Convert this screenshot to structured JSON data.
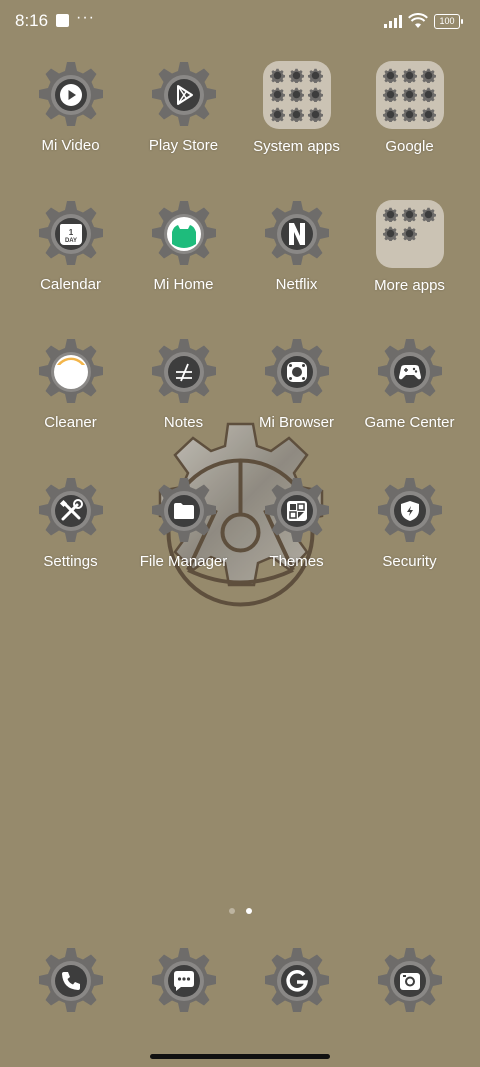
{
  "status_bar": {
    "time": "8:16",
    "battery": "100",
    "icons": [
      "notification-square-icon",
      "more-dots-icon",
      "signal-icon",
      "wifi-icon",
      "battery-icon"
    ]
  },
  "home": {
    "apps": [
      {
        "label": "Mi Video",
        "icon": "play-icon"
      },
      {
        "label": "Play Store",
        "icon": "play-store-icon"
      },
      {
        "label": "System apps",
        "icon": "folder-icon"
      },
      {
        "label": "Google",
        "icon": "folder-icon"
      },
      {
        "label": "Calendar",
        "icon": "calendar-icon",
        "glyph_text": "1\nDAY"
      },
      {
        "label": "Mi Home",
        "icon": "mi-home-icon"
      },
      {
        "label": "Netflix",
        "icon": "netflix-icon",
        "glyph_text": "N"
      },
      {
        "label": "More apps",
        "icon": "folder-icon"
      },
      {
        "label": "Cleaner",
        "icon": "cleaner-icon"
      },
      {
        "label": "Notes",
        "icon": "notes-icon"
      },
      {
        "label": "Mi Browser",
        "icon": "browser-icon"
      },
      {
        "label": "Game Center",
        "icon": "gamepad-icon"
      },
      {
        "label": "Settings",
        "icon": "tools-icon"
      },
      {
        "label": "File Manager",
        "icon": "folder-file-icon"
      },
      {
        "label": "Themes",
        "icon": "themes-icon"
      },
      {
        "label": "Security",
        "icon": "shield-icon"
      }
    ]
  },
  "page_indicator": {
    "count": 2,
    "active": 2
  },
  "dock": [
    {
      "name": "phone",
      "icon": "phone-icon"
    },
    {
      "name": "messages",
      "icon": "messages-icon"
    },
    {
      "name": "browser",
      "icon": "g-icon"
    },
    {
      "name": "camera",
      "icon": "camera-icon"
    }
  ],
  "colors": {
    "wallpaper": "#968a6c",
    "gear": "#6e6c6a",
    "gear_center": "#3e3e3e",
    "folder": "#cbc3b4"
  }
}
